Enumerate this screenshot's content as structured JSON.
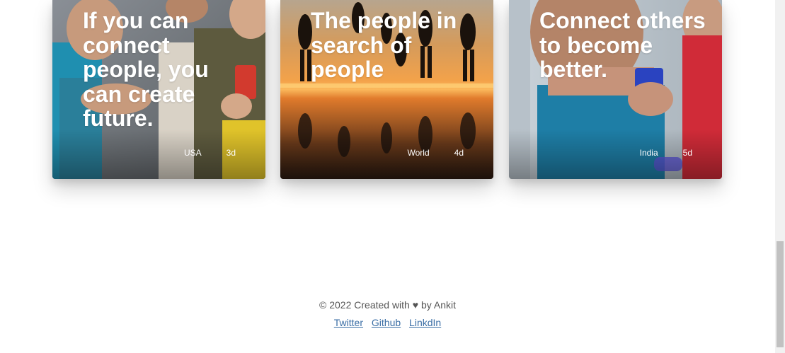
{
  "cards": [
    {
      "headline": "If you can connect people, you can create future.",
      "location": "USA",
      "age": "3d"
    },
    {
      "headline": "The people in search of people",
      "location": "World",
      "age": "4d"
    },
    {
      "headline": "Connect others to become better.",
      "location": "India",
      "age": "5d"
    }
  ],
  "footer": {
    "credit_prefix": "© 2022 Created with",
    "heart_icon": "♥",
    "credit_suffix": "by Ankit",
    "links": [
      "Twitter",
      "Github",
      "LinkdIn"
    ]
  }
}
